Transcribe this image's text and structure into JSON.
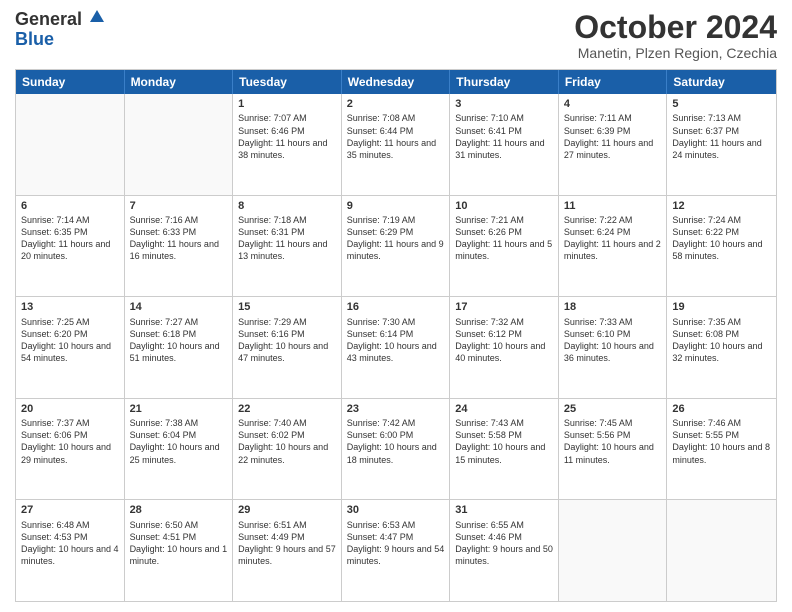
{
  "logo": {
    "general": "General",
    "blue": "Blue"
  },
  "title": "October 2024",
  "location": "Manetin, Plzen Region, Czechia",
  "days": [
    "Sunday",
    "Monday",
    "Tuesday",
    "Wednesday",
    "Thursday",
    "Friday",
    "Saturday"
  ],
  "weeks": [
    [
      {
        "day": "",
        "text": ""
      },
      {
        "day": "",
        "text": ""
      },
      {
        "day": "1",
        "text": "Sunrise: 7:07 AM\nSunset: 6:46 PM\nDaylight: 11 hours and 38 minutes."
      },
      {
        "day": "2",
        "text": "Sunrise: 7:08 AM\nSunset: 6:44 PM\nDaylight: 11 hours and 35 minutes."
      },
      {
        "day": "3",
        "text": "Sunrise: 7:10 AM\nSunset: 6:41 PM\nDaylight: 11 hours and 31 minutes."
      },
      {
        "day": "4",
        "text": "Sunrise: 7:11 AM\nSunset: 6:39 PM\nDaylight: 11 hours and 27 minutes."
      },
      {
        "day": "5",
        "text": "Sunrise: 7:13 AM\nSunset: 6:37 PM\nDaylight: 11 hours and 24 minutes."
      }
    ],
    [
      {
        "day": "6",
        "text": "Sunrise: 7:14 AM\nSunset: 6:35 PM\nDaylight: 11 hours and 20 minutes."
      },
      {
        "day": "7",
        "text": "Sunrise: 7:16 AM\nSunset: 6:33 PM\nDaylight: 11 hours and 16 minutes."
      },
      {
        "day": "8",
        "text": "Sunrise: 7:18 AM\nSunset: 6:31 PM\nDaylight: 11 hours and 13 minutes."
      },
      {
        "day": "9",
        "text": "Sunrise: 7:19 AM\nSunset: 6:29 PM\nDaylight: 11 hours and 9 minutes."
      },
      {
        "day": "10",
        "text": "Sunrise: 7:21 AM\nSunset: 6:26 PM\nDaylight: 11 hours and 5 minutes."
      },
      {
        "day": "11",
        "text": "Sunrise: 7:22 AM\nSunset: 6:24 PM\nDaylight: 11 hours and 2 minutes."
      },
      {
        "day": "12",
        "text": "Sunrise: 7:24 AM\nSunset: 6:22 PM\nDaylight: 10 hours and 58 minutes."
      }
    ],
    [
      {
        "day": "13",
        "text": "Sunrise: 7:25 AM\nSunset: 6:20 PM\nDaylight: 10 hours and 54 minutes."
      },
      {
        "day": "14",
        "text": "Sunrise: 7:27 AM\nSunset: 6:18 PM\nDaylight: 10 hours and 51 minutes."
      },
      {
        "day": "15",
        "text": "Sunrise: 7:29 AM\nSunset: 6:16 PM\nDaylight: 10 hours and 47 minutes."
      },
      {
        "day": "16",
        "text": "Sunrise: 7:30 AM\nSunset: 6:14 PM\nDaylight: 10 hours and 43 minutes."
      },
      {
        "day": "17",
        "text": "Sunrise: 7:32 AM\nSunset: 6:12 PM\nDaylight: 10 hours and 40 minutes."
      },
      {
        "day": "18",
        "text": "Sunrise: 7:33 AM\nSunset: 6:10 PM\nDaylight: 10 hours and 36 minutes."
      },
      {
        "day": "19",
        "text": "Sunrise: 7:35 AM\nSunset: 6:08 PM\nDaylight: 10 hours and 32 minutes."
      }
    ],
    [
      {
        "day": "20",
        "text": "Sunrise: 7:37 AM\nSunset: 6:06 PM\nDaylight: 10 hours and 29 minutes."
      },
      {
        "day": "21",
        "text": "Sunrise: 7:38 AM\nSunset: 6:04 PM\nDaylight: 10 hours and 25 minutes."
      },
      {
        "day": "22",
        "text": "Sunrise: 7:40 AM\nSunset: 6:02 PM\nDaylight: 10 hours and 22 minutes."
      },
      {
        "day": "23",
        "text": "Sunrise: 7:42 AM\nSunset: 6:00 PM\nDaylight: 10 hours and 18 minutes."
      },
      {
        "day": "24",
        "text": "Sunrise: 7:43 AM\nSunset: 5:58 PM\nDaylight: 10 hours and 15 minutes."
      },
      {
        "day": "25",
        "text": "Sunrise: 7:45 AM\nSunset: 5:56 PM\nDaylight: 10 hours and 11 minutes."
      },
      {
        "day": "26",
        "text": "Sunrise: 7:46 AM\nSunset: 5:55 PM\nDaylight: 10 hours and 8 minutes."
      }
    ],
    [
      {
        "day": "27",
        "text": "Sunrise: 6:48 AM\nSunset: 4:53 PM\nDaylight: 10 hours and 4 minutes."
      },
      {
        "day": "28",
        "text": "Sunrise: 6:50 AM\nSunset: 4:51 PM\nDaylight: 10 hours and 1 minute."
      },
      {
        "day": "29",
        "text": "Sunrise: 6:51 AM\nSunset: 4:49 PM\nDaylight: 9 hours and 57 minutes."
      },
      {
        "day": "30",
        "text": "Sunrise: 6:53 AM\nSunset: 4:47 PM\nDaylight: 9 hours and 54 minutes."
      },
      {
        "day": "31",
        "text": "Sunrise: 6:55 AM\nSunset: 4:46 PM\nDaylight: 9 hours and 50 minutes."
      },
      {
        "day": "",
        "text": ""
      },
      {
        "day": "",
        "text": ""
      }
    ]
  ]
}
